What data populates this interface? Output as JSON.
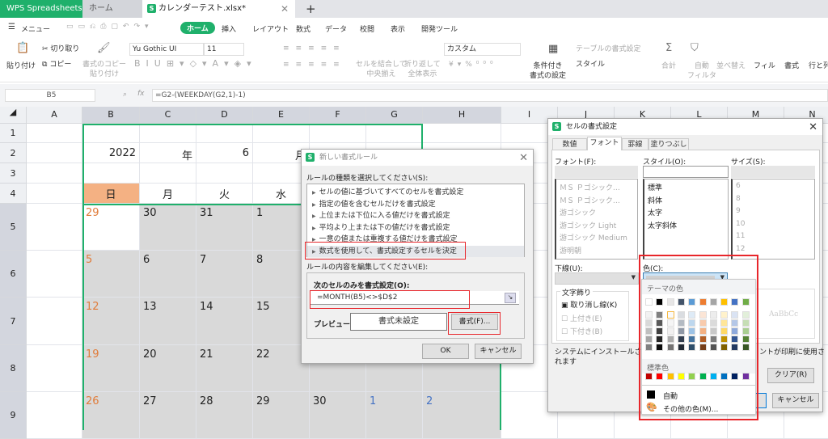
{
  "tabs": {
    "app": "WPS Spreadsheets",
    "home": "ホーム",
    "file": "カレンダーテスト.xlsx*",
    "new_tab": "+"
  },
  "menu": {
    "menu_label": "メニュー",
    "tabs": [
      "ホーム",
      "挿入",
      "レイアウト",
      "数式",
      "データ",
      "校閲",
      "表示",
      "開発ツール"
    ],
    "active": 0
  },
  "ribbon": {
    "paste": "貼り付け",
    "cut": "切り取り",
    "copy": "コピー",
    "format_painter": "書式のコピー\n貼り付け",
    "font_name": "Yu Gothic UI",
    "font_size": "11",
    "merge": "セルを結合して\n中央揃え",
    "wrap": "折り返して\n全体表示",
    "number_format": "カスタム",
    "conditional": "条件付き\n書式の設定",
    "table_format": "テーブルの書式設定",
    "style": "スタイル",
    "sum": "合計",
    "autofilter": "自動\nフィルタ",
    "sort": "並べ替え",
    "fill": "フィル",
    "format": "書式",
    "rowcol": "行と列"
  },
  "formula_bar": {
    "name_box": "B5",
    "fx": "fx",
    "formula": "=G2-(WEEKDAY(G2,1)-1)"
  },
  "sheet": {
    "columns": [
      "A",
      "B",
      "C",
      "D",
      "E",
      "F",
      "G",
      "H",
      "I",
      "J",
      "K",
      "L",
      "M",
      "N"
    ],
    "rows": [
      "1",
      "2",
      "3",
      "4",
      "5",
      "6",
      "7",
      "8",
      "9"
    ],
    "row2": [
      "2022",
      "年",
      "6",
      "月"
    ],
    "weekdays": [
      "日",
      "月",
      "火",
      "水"
    ],
    "weeks": [
      [
        "29",
        "30",
        "31",
        "1"
      ],
      [
        "5",
        "6",
        "7",
        "8"
      ],
      [
        "12",
        "13",
        "14",
        "15"
      ],
      [
        "19",
        "20",
        "21",
        "22"
      ],
      [
        "26",
        "27",
        "28",
        "29",
        "30",
        "1",
        "2"
      ]
    ],
    "sunday_color": "#e07b39",
    "next_month_color": "#4472c4",
    "header_fill": "#f4b183",
    "out_of_month_fill": "#d9d9d9",
    "selection_color": "#1fb06b"
  },
  "new_rule_dialog": {
    "title": "新しい書式ルール",
    "select_label": "ルールの種類を選択してください(S):",
    "rule_types": [
      "セルの値に基づいてすべてのセルを書式設定",
      "指定の値を含むセルだけを書式設定",
      "上位または下位に入る値だけを書式設定",
      "平均より上または下の値だけを書式設定",
      "一意の値または重複する値だけを書式設定",
      "数式を使用して、書式設定するセルを決定"
    ],
    "selected_rule": 5,
    "edit_label": "ルールの内容を編集してください(E):",
    "formula_label": "次のセルのみを書式設定(O):",
    "formula": "=MONTH(B5)<>$D$2",
    "preview_label": "プレビュー:",
    "preview_text": "書式未設定",
    "format_button": "書式(F)...",
    "ok": "OK",
    "cancel": "キャンセル"
  },
  "format_cells_dialog": {
    "title": "セルの書式設定",
    "tabs": [
      "数値",
      "フォント",
      "罫線",
      "塗りつぶし"
    ],
    "active_tab": 1,
    "font_label": "フォント(F):",
    "fonts": [
      "ＭＳ Ｐゴシック…",
      "ＭＳ Ｐゴシック…",
      "游ゴシック",
      "游ゴシック Light",
      "游ゴシック Medium",
      "游明朝"
    ],
    "style_label": "スタイル(O):",
    "styles": [
      "標準",
      "斜体",
      "太字",
      "太字斜体"
    ],
    "size_label": "サイズ(S):",
    "sizes": [
      "6",
      "8",
      "9",
      "10",
      "11",
      "12"
    ],
    "underline_label": "下線(U):",
    "color_label": "色(C):",
    "effects_label": "文字飾り",
    "strikethrough": "取り消し線(K)",
    "superscript": "上付き(E)",
    "subscript": "下付き(B)",
    "preview_sample": "AaBbCc",
    "note": "システムにインストールされてい",
    "note_tail": "ントが印刷に使用さ",
    "note2": "れます",
    "clear": "クリア(R)",
    "cancel": "キャンセル"
  },
  "color_picker": {
    "theme_label": "テーマの色",
    "theme_colors": [
      "#ffffff",
      "#000000",
      "#e7e6e6",
      "#44546a",
      "#5b9bd5",
      "#ed7d31",
      "#a5a5a5",
      "#ffc000",
      "#4472c4",
      "#70ad47"
    ],
    "standard_label": "標準色",
    "standard_colors": [
      "#c00000",
      "#ff0000",
      "#ffc000",
      "#ffff00",
      "#92d050",
      "#00b050",
      "#00b0f0",
      "#0070c0",
      "#002060",
      "#7030a0"
    ],
    "auto": "自動",
    "more": "その他の色(M)..."
  }
}
